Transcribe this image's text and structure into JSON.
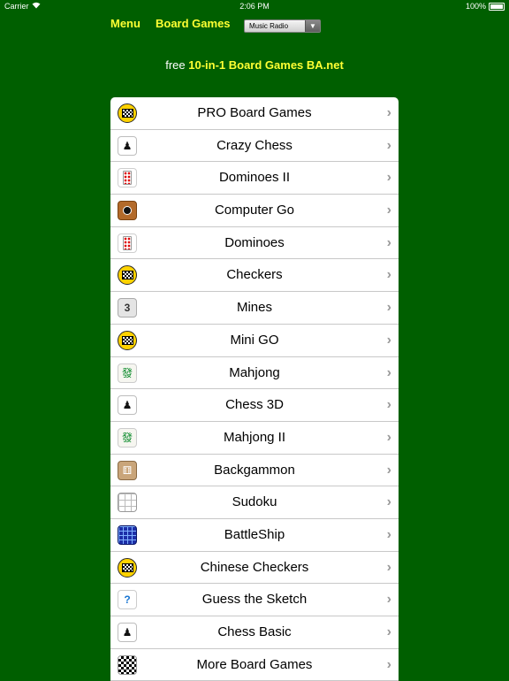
{
  "status_bar": {
    "carrier": "Carrier",
    "time": "2:06 PM",
    "battery": "100%"
  },
  "nav": {
    "menu": "Menu",
    "board_games": "Board Games",
    "music_select": "Music Radio"
  },
  "promo": {
    "prefix": "free",
    "brand": "10-in-1 Board Games BA.net"
  },
  "colors": {
    "background": "#005f00",
    "nav_link": "#ffff33"
  },
  "games": [
    {
      "label": "PRO Board Games",
      "icon": "checker-badge-icon"
    },
    {
      "label": "Crazy Chess",
      "icon": "chess-pawn-icon"
    },
    {
      "label": "Dominoes II",
      "icon": "domino-icon"
    },
    {
      "label": "Computer Go",
      "icon": "go-stone-icon"
    },
    {
      "label": "Dominoes",
      "icon": "domino-icon"
    },
    {
      "label": "Checkers",
      "icon": "checker-badge-icon"
    },
    {
      "label": "Mines",
      "icon": "minesweeper-icon"
    },
    {
      "label": "Mini GO",
      "icon": "checker-badge-icon"
    },
    {
      "label": "Mahjong",
      "icon": "mahjong-tile-icon"
    },
    {
      "label": "Chess 3D",
      "icon": "chess-pawn-icon"
    },
    {
      "label": "Mahjong II",
      "icon": "mahjong-tile-icon"
    },
    {
      "label": "Backgammon",
      "icon": "dice-icon"
    },
    {
      "label": "Sudoku",
      "icon": "sudoku-grid-icon"
    },
    {
      "label": "BattleShip",
      "icon": "battleship-grid-icon"
    },
    {
      "label": "Chinese Checkers",
      "icon": "checker-badge-icon"
    },
    {
      "label": "Guess the Sketch",
      "icon": "question-mark-icon"
    },
    {
      "label": "Chess Basic",
      "icon": "chess-pawn-icon"
    },
    {
      "label": "More Board Games",
      "icon": "checkerboard-icon"
    }
  ]
}
